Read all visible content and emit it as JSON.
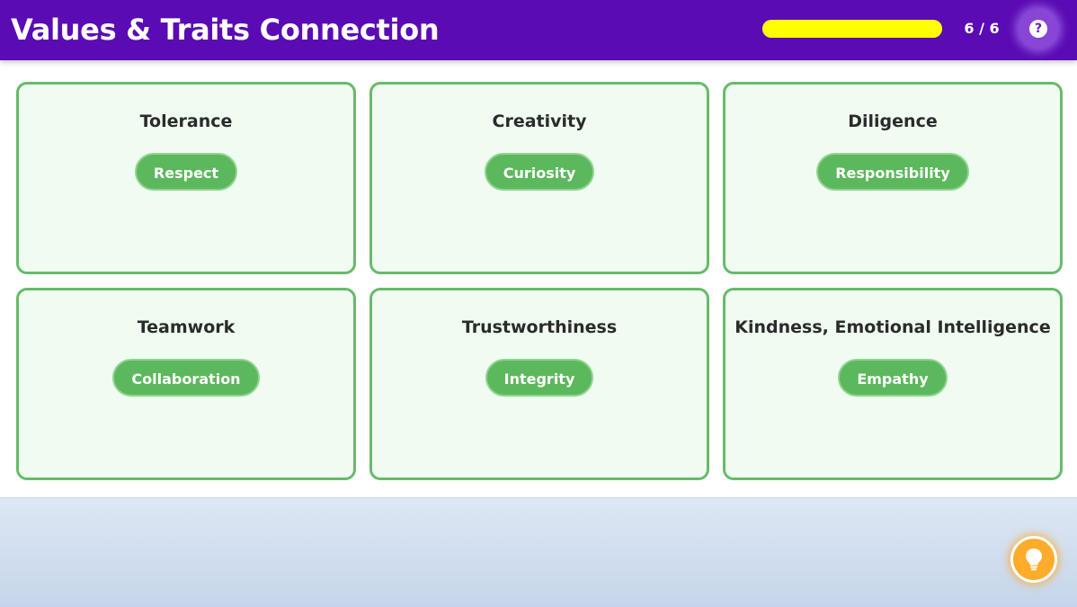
{
  "header": {
    "title": "Values & Traits Connection",
    "progress": {
      "current": 6,
      "total": 6,
      "label": "6 / 6",
      "fraction": 1.0,
      "fill_color": "#ffff00"
    },
    "help_icon": "question-mark-icon"
  },
  "cards": [
    {
      "value": "Tolerance",
      "trait": "Respect"
    },
    {
      "value": "Creativity",
      "trait": "Curiosity"
    },
    {
      "value": "Diligence",
      "trait": "Responsibility"
    },
    {
      "value": "Teamwork",
      "trait": "Collaboration"
    },
    {
      "value": "Trustworthiness",
      "trait": "Integrity"
    },
    {
      "value": "Kindness, Emotional Intelligence",
      "trait": "Empathy"
    }
  ],
  "hint_icon": "lightbulb-icon",
  "colors": {
    "header": "#5a0bb4",
    "card_border": "#66bb6a",
    "card_background": "#f0fcf1",
    "chip": "#5cb85c",
    "hint_button": "#ffab2b"
  }
}
